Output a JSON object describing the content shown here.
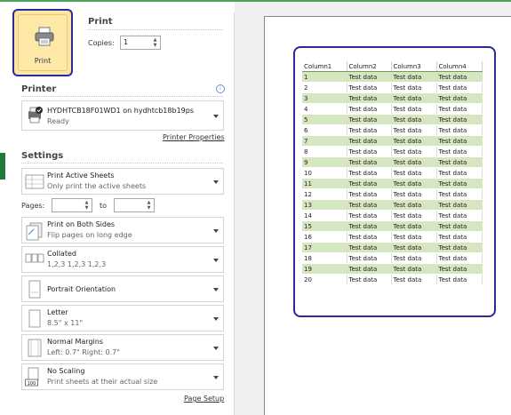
{
  "print": {
    "button_label": "Print",
    "title": "Print",
    "copies_label": "Copies:",
    "copies_value": "1"
  },
  "printer": {
    "section_title": "Printer",
    "name": "HYDHTCB18F01WD1 on hydhtcb18b19ps",
    "status": "Ready",
    "properties_link": "Printer Properties"
  },
  "settings": {
    "section_title": "Settings",
    "what": {
      "title": "Print Active Sheets",
      "subtitle": "Only print the active sheets"
    },
    "pages_label": "Pages:",
    "to_label": "to",
    "sides": {
      "title": "Print on Both Sides",
      "subtitle": "Flip pages on long edge"
    },
    "collation": {
      "title": "Collated",
      "subtitle": "1,2,3   1,2,3   1,2,3"
    },
    "orientation": {
      "title": "Portrait Orientation"
    },
    "paper": {
      "title": "Letter",
      "subtitle": "8.5\" x 11\""
    },
    "margins": {
      "title": "Normal Margins",
      "subtitle": "Left: 0.7\"   Right: 0.7\""
    },
    "scaling": {
      "title": "No Scaling",
      "subtitle": "Print sheets at their actual size",
      "icon_text": "100"
    },
    "page_setup_link": "Page Setup"
  },
  "preview": {
    "columns": [
      "Column1",
      "Column2",
      "Column3",
      "Column4"
    ],
    "rows": [
      [
        "1",
        "Test data",
        "Test data",
        "Test data"
      ],
      [
        "2",
        "Test data",
        "Test data",
        "Test data"
      ],
      [
        "3",
        "Test data",
        "Test data",
        "Test data"
      ],
      [
        "4",
        "Test data",
        "Test data",
        "Test data"
      ],
      [
        "5",
        "Test data",
        "Test data",
        "Test data"
      ],
      [
        "6",
        "Test data",
        "Test data",
        "Test data"
      ],
      [
        "7",
        "Test data",
        "Test data",
        "Test data"
      ],
      [
        "8",
        "Test data",
        "Test data",
        "Test data"
      ],
      [
        "9",
        "Test data",
        "Test data",
        "Test data"
      ],
      [
        "10",
        "Test data",
        "Test data",
        "Test data"
      ],
      [
        "11",
        "Test data",
        "Test data",
        "Test data"
      ],
      [
        "12",
        "Test data",
        "Test data",
        "Test data"
      ],
      [
        "13",
        "Test data",
        "Test data",
        "Test data"
      ],
      [
        "14",
        "Test data",
        "Test data",
        "Test data"
      ],
      [
        "15",
        "Test data",
        "Test data",
        "Test data"
      ],
      [
        "16",
        "Test data",
        "Test data",
        "Test data"
      ],
      [
        "17",
        "Test data",
        "Test data",
        "Test data"
      ],
      [
        "18",
        "Test data",
        "Test data",
        "Test data"
      ],
      [
        "19",
        "Test data",
        "Test data",
        "Test data"
      ],
      [
        "20",
        "Test data",
        "Test data",
        "Test data"
      ]
    ]
  },
  "colors": {
    "accent": "#2b2b90",
    "row_band": "#d5e6c0",
    "print_button": "#fbe7a5"
  }
}
